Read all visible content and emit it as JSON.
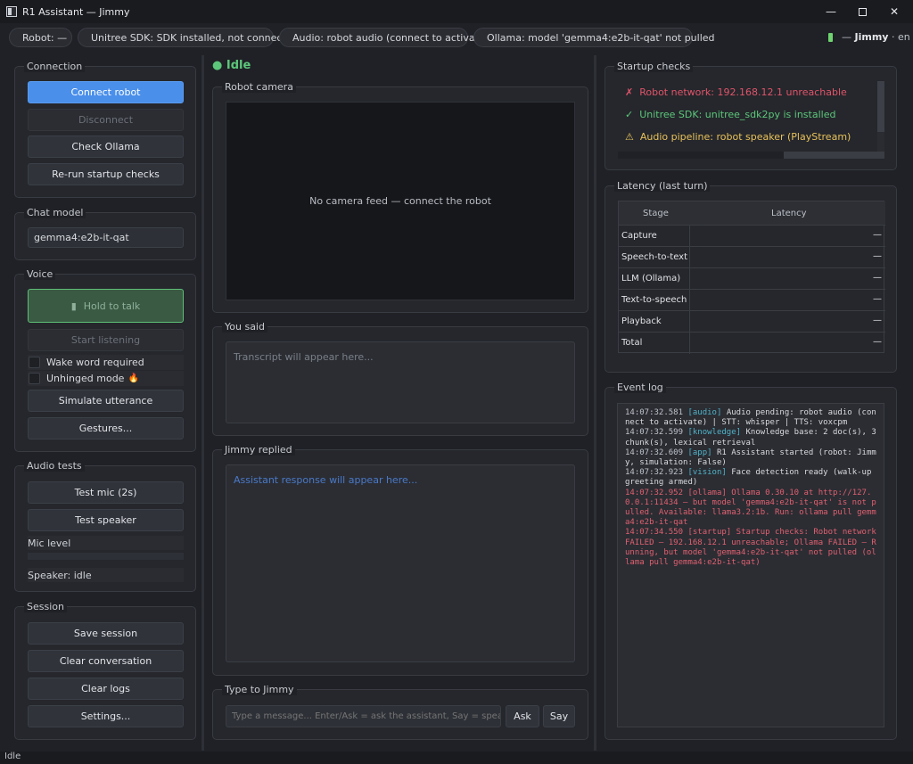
{
  "window": {
    "title": "R1 Assistant — Jimmy",
    "minimize": "—",
    "close": "✕"
  },
  "status_chips": {
    "robot": "Robot: —",
    "sdk": "Unitree SDK: SDK installed, not connected",
    "audio": "Audio: robot audio (connect to activate)",
    "ollama": "Ollama: model 'gemma4:e2b-it-qat' not pulled"
  },
  "robot_identity": {
    "prefix": "—",
    "name": "Jimmy",
    "lang": "· en"
  },
  "connection": {
    "title": "Connection",
    "connect": "Connect robot",
    "disconnect": "Disconnect",
    "check_ollama": "Check Ollama",
    "rerun_checks": "Re-run startup checks"
  },
  "chat_model": {
    "title": "Chat model",
    "value": "gemma4:e2b-it-qat"
  },
  "voice": {
    "title": "Voice",
    "hold_to_talk": "Hold to talk",
    "start_listening": "Start listening",
    "wake_word": "Wake word required",
    "unhinged": "Unhinged mode",
    "unhinged_emoji": "🔥",
    "simulate": "Simulate utterance",
    "gestures": "Gestures..."
  },
  "audio_tests": {
    "title": "Audio tests",
    "test_mic": "Test mic (2s)",
    "test_speaker": "Test speaker",
    "mic_level": "Mic level",
    "mic_level_value": 0,
    "speaker_status": "Speaker: idle"
  },
  "session": {
    "title": "Session",
    "save": "Save session",
    "clear_conversation": "Clear conversation",
    "clear_logs": "Clear logs",
    "settings": "Settings..."
  },
  "center": {
    "state": "● Idle",
    "camera_title": "Robot camera",
    "camera_placeholder": "No camera feed — connect the robot",
    "you_said_title": "You said",
    "you_said_placeholder": "Transcript will appear here...",
    "replied_title": "Jimmy replied",
    "replied_placeholder": "Assistant response will appear here...",
    "type_title": "Type to Jimmy",
    "input_placeholder": "Type a message... Enter/Ask = ask the assistant, Say = speak i...",
    "ask": "Ask",
    "say": "Say"
  },
  "startup_checks": {
    "title": "Startup checks",
    "items": [
      {
        "icon": "✗",
        "text": "Robot network: 192.168.12.1 unreachable",
        "status": "error"
      },
      {
        "icon": "✓",
        "text": "Unitree SDK: unitree_sdk2py is installed",
        "status": "ok"
      },
      {
        "icon": "⚠",
        "text": "Audio pipeline: robot speaker (PlayStream)",
        "status": "warn"
      }
    ]
  },
  "latency": {
    "title": "Latency (last turn)",
    "headers": [
      "Stage",
      "Latency"
    ],
    "rows": [
      {
        "stage": "Capture",
        "value": "—"
      },
      {
        "stage": "Speech-to-text",
        "value": "—"
      },
      {
        "stage": "LLM (Ollama)",
        "value": "—"
      },
      {
        "stage": "Text-to-speech",
        "value": "—"
      },
      {
        "stage": "Playback",
        "value": "—"
      },
      {
        "stage": "Total",
        "value": "—"
      }
    ]
  },
  "event_log": {
    "title": "Event log",
    "entries": [
      {
        "ts": "14:07:32.581",
        "tag": "[audio]",
        "msg": "Audio pending: robot audio (connect to activate) | STT: whisper | TTS: voxcpm",
        "level": "info"
      },
      {
        "ts": "14:07:32.599",
        "tag": "[knowledge]",
        "msg": "Knowledge base: 2 doc(s), 3 chunk(s), lexical retrieval",
        "level": "info"
      },
      {
        "ts": "14:07:32.609",
        "tag": "[app]",
        "msg": "R1 Assistant started (robot: Jimmy, simulation: False)",
        "level": "info"
      },
      {
        "ts": "14:07:32.923",
        "tag": "[vision]",
        "msg": "Face detection ready (walk-up greeting armed)",
        "level": "info"
      },
      {
        "ts": "14:07:32.952",
        "tag": "[ollama]",
        "msg": "Ollama 0.30.10 at http://127.0.0.1:11434 — but model 'gemma4:e2b-it-qat' is not pulled. Available: llama3.2:1b. Run: ollama pull gemma4:e2b-it-qat",
        "level": "error"
      },
      {
        "ts": "14:07:34.550",
        "tag": "[startup]",
        "msg": "Startup checks: Robot network FAILED — 192.168.12.1 unreachable; Ollama FAILED — Running, but model 'gemma4:e2b-it-qat' not pulled (ollama pull gemma4:e2b-it-qat)",
        "level": "error"
      }
    ]
  },
  "statusbar": {
    "text": "Idle"
  },
  "colors": {
    "accent": "#4a8fea",
    "ok": "#5cc77a",
    "error": "#e0546a",
    "warn": "#e8c15a"
  }
}
